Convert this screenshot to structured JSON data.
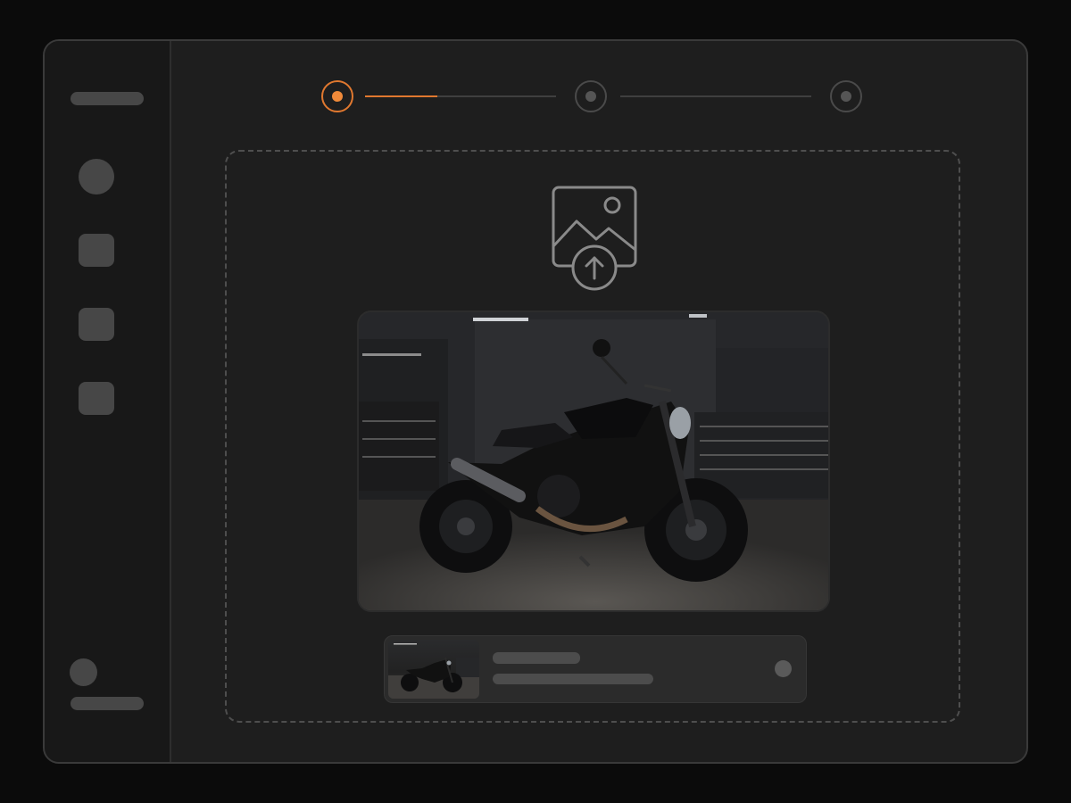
{
  "colors": {
    "accent": "#f08a3a",
    "background": "#0b0b0b",
    "window": "#1e1e1e",
    "sidebar": "#181818",
    "placeholder": "#474747"
  },
  "sidebar": {
    "icons": [
      "avatar-icon",
      "nav-square-icon",
      "nav-square-icon",
      "nav-square-icon",
      "user-avatar-icon"
    ]
  },
  "stepper": {
    "steps": [
      {
        "state": "active"
      },
      {
        "state": "inactive"
      },
      {
        "state": "inactive"
      }
    ],
    "progress": 0.38
  },
  "dropzone": {
    "icon": "image-upload-icon"
  },
  "preview": {
    "subject": "motorcycle-photo"
  },
  "file_card": {
    "action_icon": "dot-icon"
  }
}
